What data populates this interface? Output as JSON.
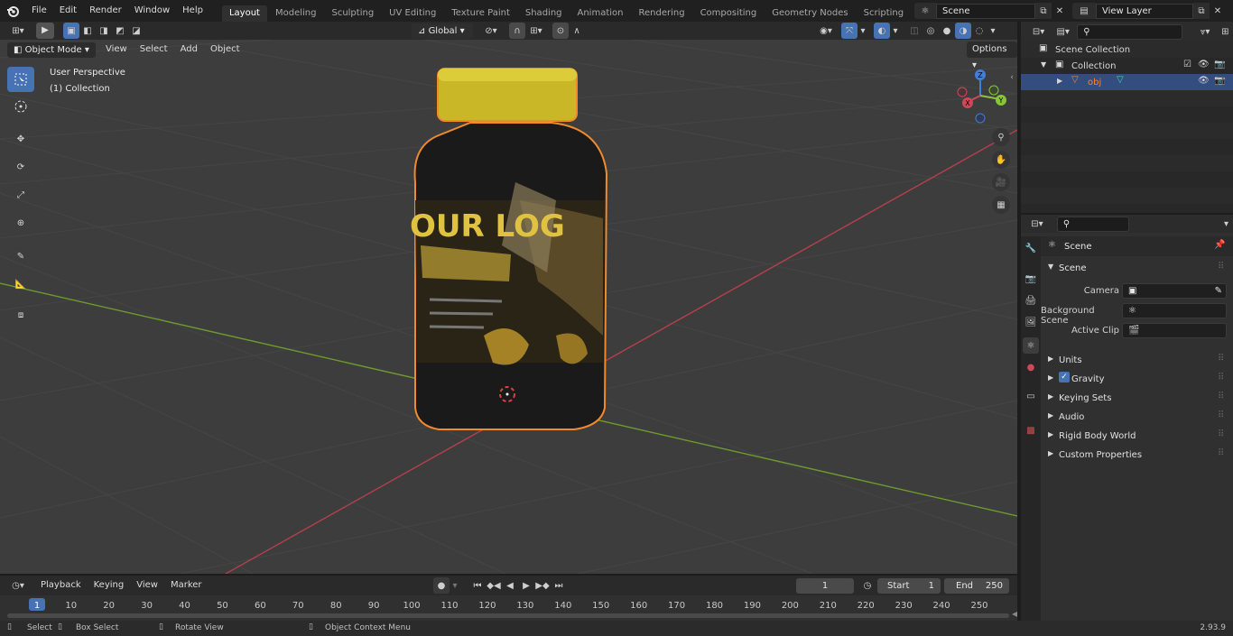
{
  "topbar": {
    "menus": [
      "File",
      "Edit",
      "Render",
      "Window",
      "Help"
    ],
    "workspaces": [
      "Layout",
      "Modeling",
      "Sculpting",
      "UV Editing",
      "Texture Paint",
      "Shading",
      "Animation",
      "Rendering",
      "Compositing",
      "Geometry Nodes",
      "Scripting"
    ],
    "active_workspace": "Layout",
    "add_tab": "+",
    "scene_name": "Scene",
    "view_layer": "View Layer"
  },
  "viewport_header": {
    "mode": "Object Mode",
    "menus": [
      "View",
      "Select",
      "Add",
      "Object"
    ],
    "transform_orientation": "Global",
    "options_label": "Options"
  },
  "viewport": {
    "perspective_label": "User Perspective",
    "collection_label": "(1) Collection",
    "gizmo_axes": {
      "x": "X",
      "y": "Y",
      "z": "Z"
    },
    "colors": {
      "x_axis": "#d0475a",
      "y_axis": "#8ac43a",
      "z_axis": "#3f7fd6",
      "selection": "#f28729"
    },
    "label_text": "OUR LOG"
  },
  "outliner": {
    "items": [
      {
        "label": "Scene Collection"
      },
      {
        "label": "Collection"
      },
      {
        "label": "obj"
      }
    ]
  },
  "properties": {
    "context_label": "Scene",
    "panel_title": "Scene",
    "fields": [
      {
        "label": "Camera"
      },
      {
        "label": "Background Scene"
      },
      {
        "label": "Active Clip"
      }
    ],
    "subpanels": [
      "Units",
      "Gravity",
      "Keying Sets",
      "Audio",
      "Rigid Body World",
      "Custom Properties"
    ],
    "gravity_checked": true
  },
  "timeline": {
    "menus": [
      "Playback",
      "Keying",
      "View",
      "Marker"
    ],
    "current_frame": "1",
    "start_label": "Start",
    "start_value": "1",
    "end_label": "End",
    "end_value": "250",
    "ticks": [
      "1",
      "10",
      "20",
      "30",
      "40",
      "50",
      "60",
      "70",
      "80",
      "90",
      "100",
      "110",
      "120",
      "130",
      "140",
      "150",
      "160",
      "170",
      "180",
      "190",
      "200",
      "210",
      "220",
      "230",
      "240",
      "250"
    ]
  },
  "statusbar": {
    "select": "Select",
    "box_select": "Box Select",
    "rotate_view": "Rotate View",
    "context_menu": "Object Context Menu",
    "version": "2.93.9"
  }
}
